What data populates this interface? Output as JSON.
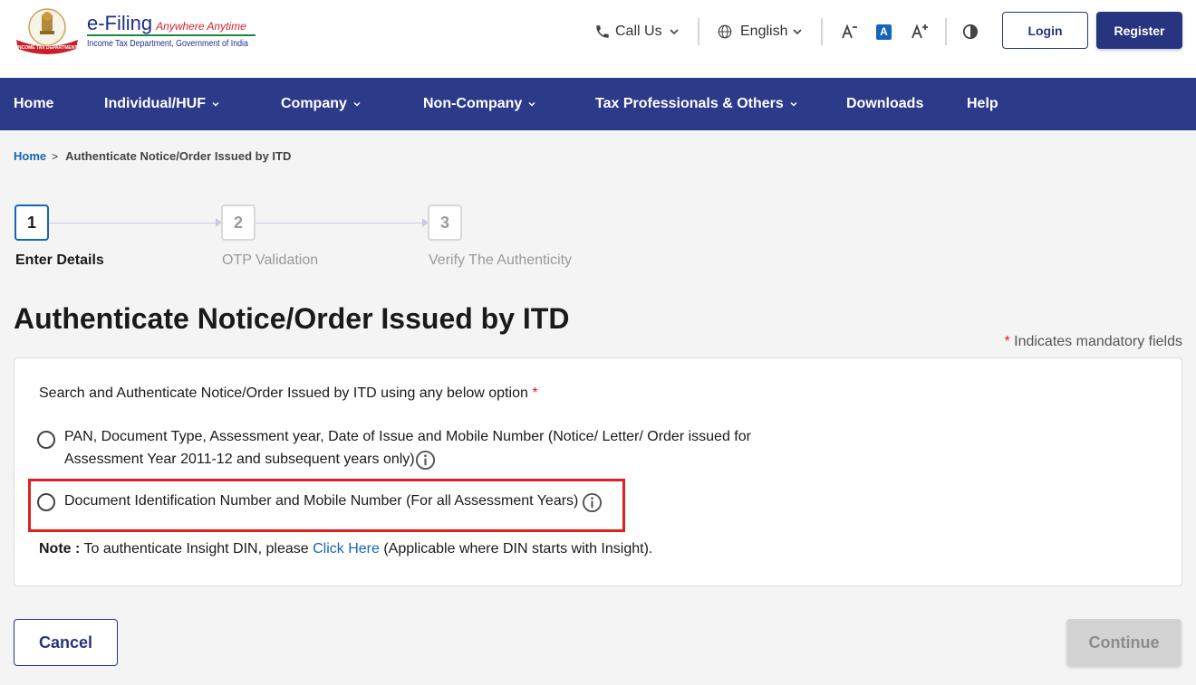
{
  "brand": {
    "title": "e-Filing",
    "tagline": "Anywhere Anytime",
    "subtitle": "Income Tax Department, Government of India",
    "emblem_ribbon": "INCOME TAX DEPARTMENT",
    "primary_color": "#2c3a8a",
    "accent_color": "#d3232f"
  },
  "topbar": {
    "call_us": "Call Us",
    "language": "English",
    "icons": [
      "phone-icon",
      "chevron-down-icon",
      "globe-icon",
      "text-decrease-icon",
      "text-reset-icon",
      "text-increase-icon",
      "contrast-icon"
    ],
    "font_reset_glyph": "A",
    "login": "Login",
    "register": "Register"
  },
  "nav": {
    "items": [
      {
        "label": "Home"
      },
      {
        "label": "Individual/HUF"
      },
      {
        "label": "Company"
      },
      {
        "label": "Non-Company"
      },
      {
        "label": "Tax Professionals & Others"
      },
      {
        "label": "Downloads"
      },
      {
        "label": "Help"
      }
    ]
  },
  "breadcrumb": {
    "home": "Home",
    "separator": ">",
    "current": "Authenticate Notice/Order Issued by ITD"
  },
  "stepper": {
    "steps": [
      {
        "number": "1",
        "label": "Enter Details",
        "state": "active"
      },
      {
        "number": "2",
        "label": "OTP Validation",
        "state": "inactive"
      },
      {
        "number": "3",
        "label": "Verify The Authenticity",
        "state": "inactive"
      }
    ]
  },
  "page": {
    "title": "Authenticate Notice/Order Issued by ITD",
    "mandatory_star": "*",
    "mandatory_note": "Indicates mandatory fields"
  },
  "form": {
    "lead": "Search and Authenticate Notice/Order Issued by ITD using any below option",
    "lead_star": "*",
    "option1_line1": "PAN, Document Type, Assessment year, Date of Issue and Mobile Number (Notice/ Letter/ Order issued for",
    "option1_line2": "Assessment Year 2011-12 and subsequent years only)",
    "option2": "Document Identification Number and Mobile Number (For all Assessment Years)",
    "note_label": "Note :",
    "note_text_before": "To authenticate Insight DIN, please",
    "note_link": "Click Here",
    "note_text_after": "(Applicable where DIN starts with Insight).",
    "highlight_color": "#e02020"
  },
  "actions": {
    "cancel": "Cancel",
    "continue": "Continue"
  }
}
